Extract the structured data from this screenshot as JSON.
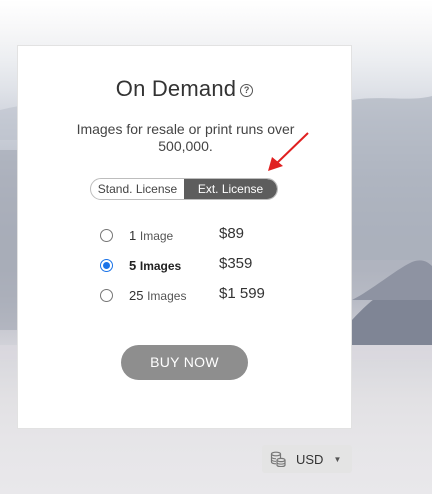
{
  "card": {
    "title": "On Demand",
    "help_glyph": "?",
    "description": "Images for resale or print runs over 500,000."
  },
  "license_toggle": {
    "options": [
      "Stand. License",
      "Ext. License"
    ],
    "selected": "Ext. License"
  },
  "packages": [
    {
      "count": "1",
      "unit": "Image",
      "price": "$89",
      "selected": false
    },
    {
      "count": "5",
      "unit": "Images",
      "price": "$359",
      "selected": true
    },
    {
      "count": "25",
      "unit": "Images",
      "price": "$1 599",
      "selected": false
    }
  ],
  "buy_button": "BUY NOW",
  "currency": {
    "code": "USD",
    "icon": "coins-icon",
    "caret_glyph": "▼"
  },
  "colors": {
    "accent_radio": "#1a73e8",
    "annotation_arrow": "#e02020",
    "toggle_active": "#5d5d5d",
    "button": "#8e8e8e"
  }
}
